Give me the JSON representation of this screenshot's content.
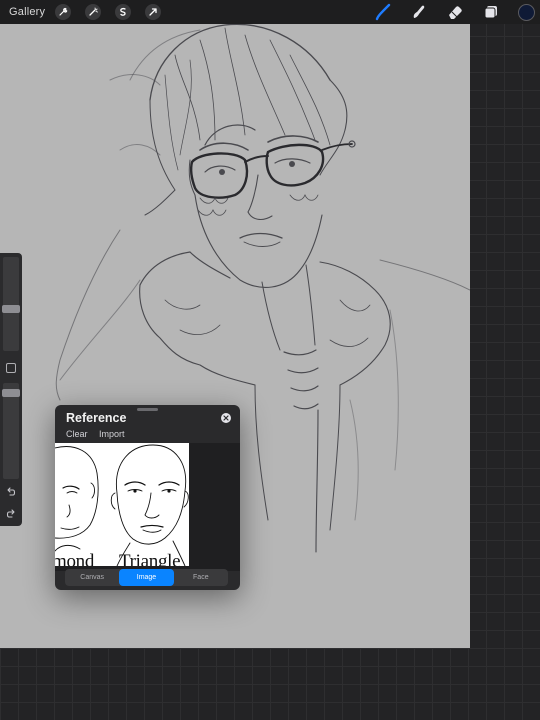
{
  "topbar": {
    "gallery_label": "Gallery",
    "left_tools": [
      "wrench-icon",
      "magic-wand-icon",
      "selection-icon",
      "transform-arrow-icon"
    ],
    "right_tools": [
      "brush-icon",
      "smudge-icon",
      "eraser-icon",
      "layers-icon"
    ],
    "current_color": "#0f1a36",
    "active_tool": "brush"
  },
  "sidebar": {
    "brush_size_level": 0.25,
    "opacity_level": 0.08,
    "icons": [
      "square-modify-icon",
      "undo-icon",
      "redo-icon"
    ]
  },
  "reference": {
    "title": "Reference",
    "actions": [
      "Clear",
      "Import"
    ],
    "image_caption_left": "mond",
    "image_caption_right": "Triangle",
    "modes": [
      "Canvas",
      "Image",
      "Face"
    ],
    "active_mode": "Image"
  },
  "colors": {
    "accent": "#0a84ff",
    "canvas": "#b6b6b6",
    "toolbar": "#1e1e1f"
  }
}
